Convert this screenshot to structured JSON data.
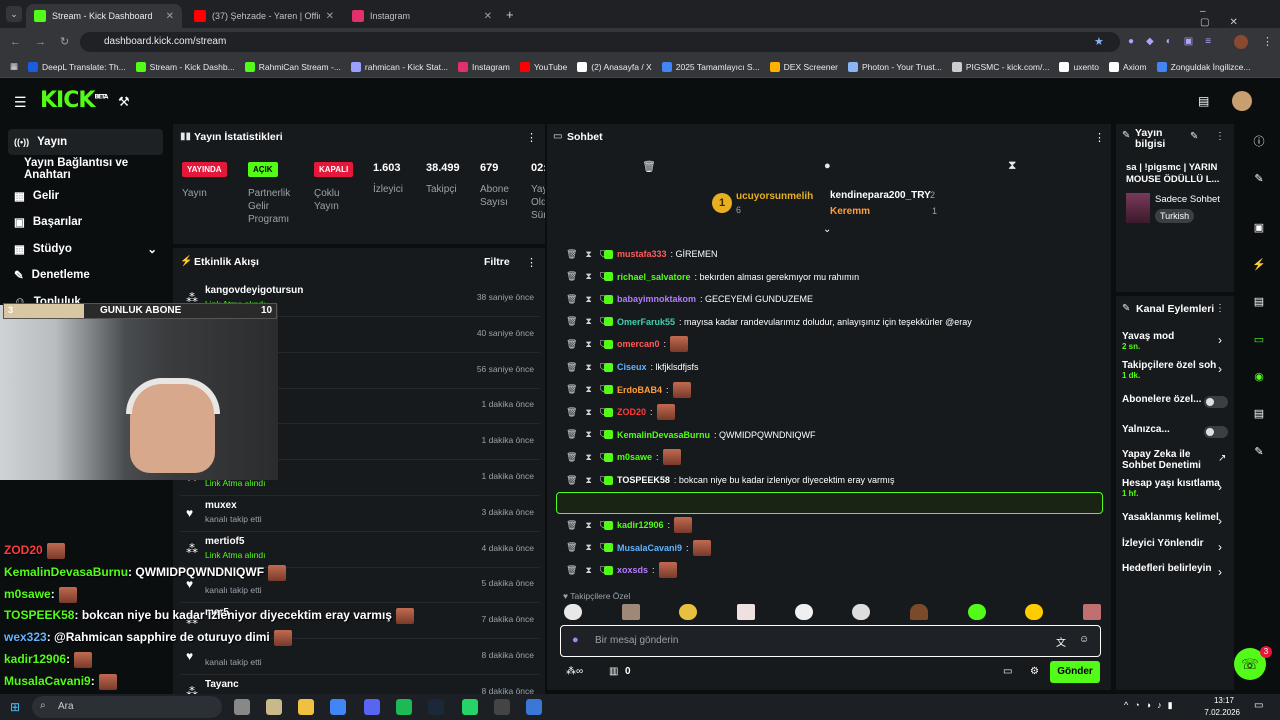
{
  "browser": {
    "tabs": [
      {
        "label": "Stream - Kick Dashboard",
        "color": "#53fc18"
      },
      {
        "label": "(37) Şehzade - Yaren | Official V",
        "color": "#ff0000"
      },
      {
        "label": "Instagram",
        "color": "#e1306c"
      }
    ],
    "url": "dashboard.kick.com/stream",
    "bookmarks": [
      "DeepL Translate: Th...",
      "Stream - Kick Dashb...",
      "RahmiCan Stream -...",
      "rahmican - Kick Stat...",
      "Instagram",
      "YouTube",
      "(2) Anasayfa / X",
      "2025 Tamamlayıcı S...",
      "DEX Screener",
      "Photon - Your Trust...",
      "PIGSMC - kick.com/...",
      "uxento",
      "Axiom",
      "Zonguldak İngilizce..."
    ]
  },
  "header": {
    "logo": "KICK",
    "beta": "BETA"
  },
  "sidebar": {
    "items": [
      "Yayın",
      "Yayın Bağlantısı ve Anahtarı",
      "Gelir",
      "Başarılar",
      "Stüdyo",
      "Denetleme",
      "Topluluk"
    ]
  },
  "stats": {
    "title": "Yayın İstatistikleri",
    "badges": [
      {
        "label": "YAYINDA",
        "sub": "Yayın"
      },
      {
        "label": "AÇIK",
        "sub": "Partnerlik Gelir Programı"
      },
      {
        "label": "KAPALI",
        "sub": "Çoklu Yayın"
      }
    ],
    "values": [
      {
        "val": "1.603",
        "lab": "İzleyici"
      },
      {
        "val": "38.499",
        "lab": "Takipçi"
      },
      {
        "val": "679",
        "lab": "Abone Sayısı"
      },
      {
        "val": "02:",
        "lab": "Yay Old Sür"
      }
    ]
  },
  "activity": {
    "title": "Etkinlik Akışı",
    "filter": "Filtre",
    "items": [
      {
        "name": "kangovdeyigotursun",
        "sub": "Link Atma alındı",
        "time": "38 saniye önce"
      },
      {
        "name": "",
        "sub": "",
        "time": "40 saniye önce"
      },
      {
        "name": "",
        "sub": "",
        "time": "56 saniye önce"
      },
      {
        "name": "",
        "sub": "",
        "time": "1 dakika önce"
      },
      {
        "name": "",
        "sub": "",
        "time": "1 dakika önce"
      },
      {
        "name": "",
        "sub": "Link Atma alındı",
        "time": "1 dakika önce"
      },
      {
        "name": "muxex",
        "sub": "kanalı takip etti",
        "time": "3 dakika önce"
      },
      {
        "name": "mertiof5",
        "sub": "Link Atma alındı",
        "time": "4 dakika önce"
      },
      {
        "name": "",
        "sub": "kanalı takip etti",
        "time": "5 dakika önce"
      },
      {
        "name": "mer5",
        "sub": "",
        "time": "7 dakika önce"
      },
      {
        "name": "",
        "sub": "kanalı takip etti",
        "time": "8 dakika önce"
      },
      {
        "name": "Tayanc",
        "sub": "",
        "time": "8 dakika önce"
      }
    ]
  },
  "overlay": {
    "goal": {
      "count": "3",
      "label": "GUNLUK ABONE",
      "target": "10"
    },
    "chat": [
      {
        "user": "ZOD20",
        "text": "",
        "color": "#ff3b3b"
      },
      {
        "user": "KemalinDevasaBurnu",
        "text": ": QWMIDPQWNDNIQWF",
        "color": "#53fc18"
      },
      {
        "user": "m0sawe",
        "text": ":",
        "color": "#53fc18"
      },
      {
        "user": "TOSPEEK58",
        "text": ": bokcan niye bu kadar izleniyor diyecektim eray varmış",
        "color": "#53fc18"
      },
      {
        "user": "wex323",
        "text": ": @Rahmican sapphire de oturuyo dimi",
        "color": "#5fb3ff"
      },
      {
        "user": "kadir12906",
        "text": ":",
        "color": "#53fc18"
      },
      {
        "user": "MusalaCavani9",
        "text": ":",
        "color": "#53fc18"
      }
    ]
  },
  "chat": {
    "title": "Sohbet",
    "top": [
      {
        "name": "ucuyorsunmelih",
        "val": "6"
      },
      {
        "name": "kendinepara200_TRY",
        "val": "2"
      },
      {
        "name": "Keremm",
        "val": "1"
      }
    ],
    "messages": [
      {
        "user": "mustafa333",
        "text": ": GİREMEN",
        "color": "#ff5b5b"
      },
      {
        "user": "richael_salvatore",
        "text": ": bekırden alması gerekmıyor mu rahımın",
        "color": "#53fc18"
      },
      {
        "user": "babayimnoktakom",
        "text": ": GECEYEMİ GUNDUZEME",
        "color": "#b57bff"
      },
      {
        "user": "OmerFaruk55",
        "text": ": mayısa kadar randevularımız doludur, anlayışınız için teşekkürler @eray",
        "color": "#3ecfb0"
      },
      {
        "user": "omercan0",
        "text": ":",
        "color": "#ff5b5b"
      },
      {
        "user": "Ciseux",
        "text": ": lkfjklsdfjsfs",
        "color": "#5fb3ff"
      },
      {
        "user": "ErdoBAB4",
        "text": ":",
        "color": "#ff9f3b"
      },
      {
        "user": "ZOD20",
        "text": ":",
        "color": "#ff3b3b"
      },
      {
        "user": "KemalinDevasaBurnu",
        "text": ": QWMIDPQWNDNIQWF",
        "color": "#53fc18"
      },
      {
        "user": "m0sawe",
        "text": ":",
        "color": "#53fc18"
      },
      {
        "user": "TOSPEEK58",
        "text": ": bokcan niye bu kadar izleniyor diyecektim eray varmış",
        "color": "#ffffff"
      },
      {
        "user": "wex323",
        "text": ": @Rahmican sapphire de oturuyo dimi",
        "color": "#5fb3ff"
      },
      {
        "user": "kadir12906",
        "text": ":",
        "color": "#53fc18"
      },
      {
        "user": "MusalaCavani9",
        "text": ":",
        "color": "#5fb3ff"
      },
      {
        "user": "xoxsds",
        "text": ":",
        "color": "#b57bff"
      }
    ],
    "followers_label": "Takipçilere Özel",
    "placeholder": "Bir mesaj gönderin",
    "send": "Gönder",
    "count": "0",
    "mention": "@Rahmican"
  },
  "info": {
    "title": "Yayın bilgisi",
    "stream_title": "sa | !pigsmc | YARIN MOUSE ÖDÜLLÜ L...",
    "category": "Sadece Sohbet",
    "tag": "Turkish"
  },
  "channel": {
    "title": "Kanal Eylemleri",
    "items": [
      {
        "label": "Yavaş mod",
        "sub": "2 sn."
      },
      {
        "label": "Takipçilere özel soh",
        "sub": "1 dk."
      },
      {
        "label": "Abonelere özel...",
        "sub": ""
      },
      {
        "label": "Yalnızca...",
        "sub": ""
      },
      {
        "label": "Yapay Zeka ile Sohbet Denetimi",
        "sub": ""
      },
      {
        "label": "Hesap yaşı kısıtlama",
        "sub": "1 hf."
      },
      {
        "label": "Yasaklanmış kelimel",
        "sub": ""
      },
      {
        "label": "İzleyici Yönlendir",
        "sub": ""
      },
      {
        "label": "Hedefleri belirleyin",
        "sub": ""
      }
    ]
  },
  "taskbar": {
    "search": "Ara",
    "time": "13:17",
    "date": "7.02.2026"
  },
  "notif": "3"
}
